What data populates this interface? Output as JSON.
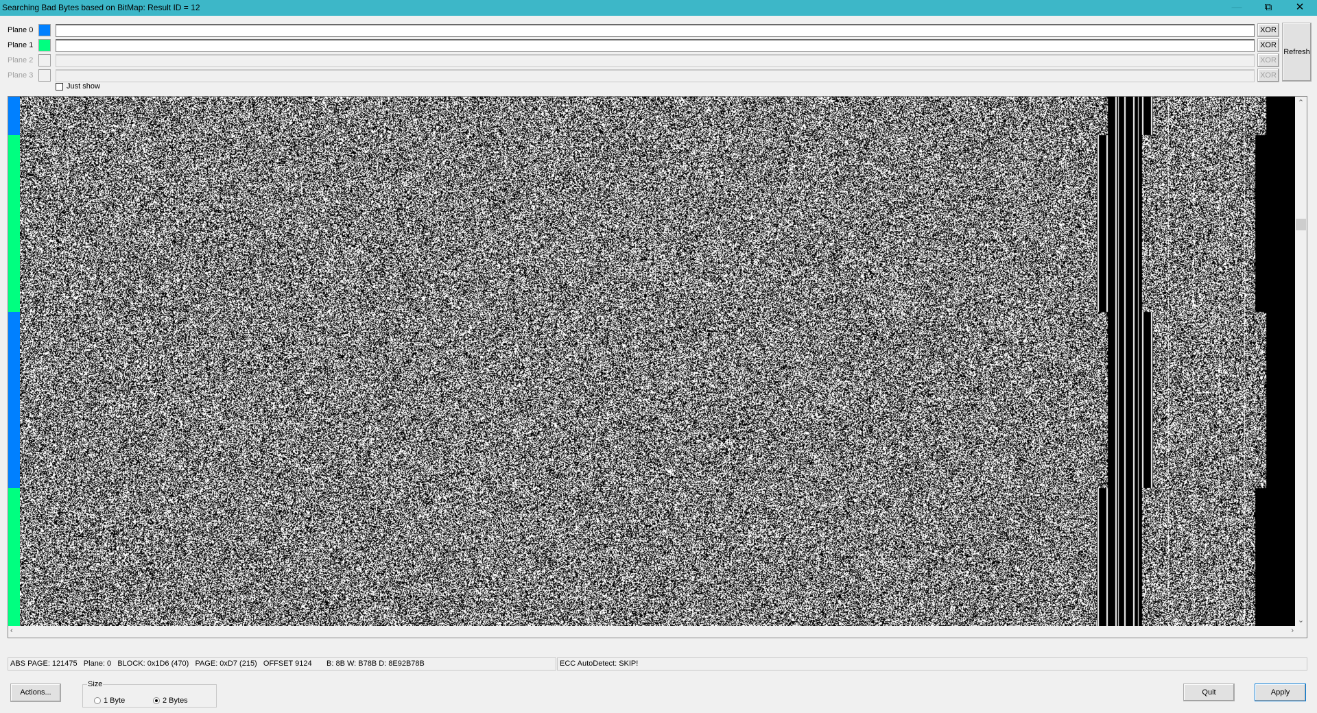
{
  "window": {
    "title": "Searching Bad Bytes based on BitMap: Result ID = 12",
    "minimize_icon": "minimize-icon",
    "restore_icon": "restore-icon",
    "close_icon": "close-icon"
  },
  "planes": [
    {
      "label": "Plane 0",
      "color": "#0080ff",
      "enabled": true,
      "value": "",
      "xor": "XOR"
    },
    {
      "label": "Plane 1",
      "color": "#00ff80",
      "enabled": true,
      "value": "",
      "xor": "XOR"
    },
    {
      "label": "Plane 2",
      "color": "",
      "enabled": false,
      "value": "",
      "xor": "XOR"
    },
    {
      "label": "Plane 3",
      "color": "",
      "enabled": false,
      "value": "",
      "xor": "XOR"
    }
  ],
  "refresh_label": "Refresh",
  "just_show": {
    "label": "Just show",
    "checked": false
  },
  "bitmap": {
    "plane_sequence": [
      0,
      1,
      0,
      1
    ]
  },
  "status": {
    "left": "ABS PAGE: 121475   Plane: 0   BLOCK: 0x1D6 (470)   PAGE: 0xD7 (215)   OFFSET 9124       B: 8B W: B78B D: 8E92B78B",
    "right": "ECC AutoDetect: SKIP!"
  },
  "actions_label": "Actions...",
  "size": {
    "legend": "Size",
    "options": [
      "1 Byte",
      "2 Bytes"
    ],
    "selected": "2 Bytes"
  },
  "quit_label": "Quit",
  "apply_label": "Apply"
}
